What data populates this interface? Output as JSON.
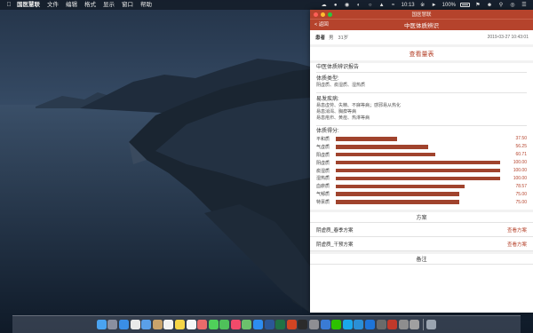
{
  "menubar": {
    "app_name": "国医慧联",
    "menus": [
      "文件",
      "编辑",
      "格式",
      "显示",
      "窗口",
      "帮助"
    ],
    "clock": "10:13",
    "battery": "100%"
  },
  "window": {
    "title": "国医慧联",
    "nav_back": "< 返回",
    "nav_title": "中医体质辨识"
  },
  "patient": {
    "label": "患者",
    "gender": "男",
    "age": "31岁",
    "datetime": "2019-03-27 10:43:01"
  },
  "view_button": "查看量表",
  "report": {
    "title": "中医体质辨识报告",
    "constitution_head": "体质类型:",
    "constitution_text": "阴虚质、痰湿质、湿热质",
    "disease_head": "易发疾病:",
    "disease_lines": [
      "易患虚劳、失精、不寐等病；感邪易从热化",
      "易患消渴、胸痹等病",
      "易患疮疖、黄疸、热淋等病"
    ],
    "score_head": "体质得分:"
  },
  "scores": [
    {
      "label": "平和质",
      "value": "37.50",
      "level": 37.5
    },
    {
      "label": "气虚质",
      "value": "56.25",
      "level": 56.25
    },
    {
      "label": "阳虚质",
      "value": "60.71",
      "level": 60.71
    },
    {
      "label": "阴虚质",
      "value": "100.00",
      "level": 100
    },
    {
      "label": "痰湿质",
      "value": "100.00",
      "level": 100
    },
    {
      "label": "湿热质",
      "value": "100.00",
      "level": 100
    },
    {
      "label": "血瘀质",
      "value": "78.57",
      "level": 78.57
    },
    {
      "label": "气郁质",
      "value": "75.00",
      "level": 75
    },
    {
      "label": "特禀质",
      "value": "75.00",
      "level": 75
    }
  ],
  "plan": {
    "head": "方案",
    "items": [
      {
        "name": "阴虚质_春季方案",
        "link": "查看方案"
      },
      {
        "name": "阴虚质_干预方案",
        "link": "查看方案"
      }
    ]
  },
  "notes": {
    "head": "备注"
  },
  "colors": {
    "accent": "#b5432c",
    "bar": "#a0432d"
  },
  "dock_icons": [
    "finder-icon",
    "launchpad-icon",
    "safari-icon",
    "chrome-icon",
    "mail-icon",
    "contacts-icon",
    "calendar-icon",
    "notes-icon",
    "reminders-icon",
    "photos-icon",
    "messages-icon",
    "facetime-icon",
    "music-icon",
    "maps-icon",
    "appstore-icon",
    "word-icon",
    "excel-icon",
    "powerpoint-icon",
    "terminal-icon",
    "settings-icon",
    "xcode-icon",
    "wechat-icon",
    "qq-icon",
    "vscode-icon",
    "sourcetree-icon",
    "app-icon",
    "app-icon",
    "app-icon",
    "app-icon",
    "trash-icon"
  ]
}
